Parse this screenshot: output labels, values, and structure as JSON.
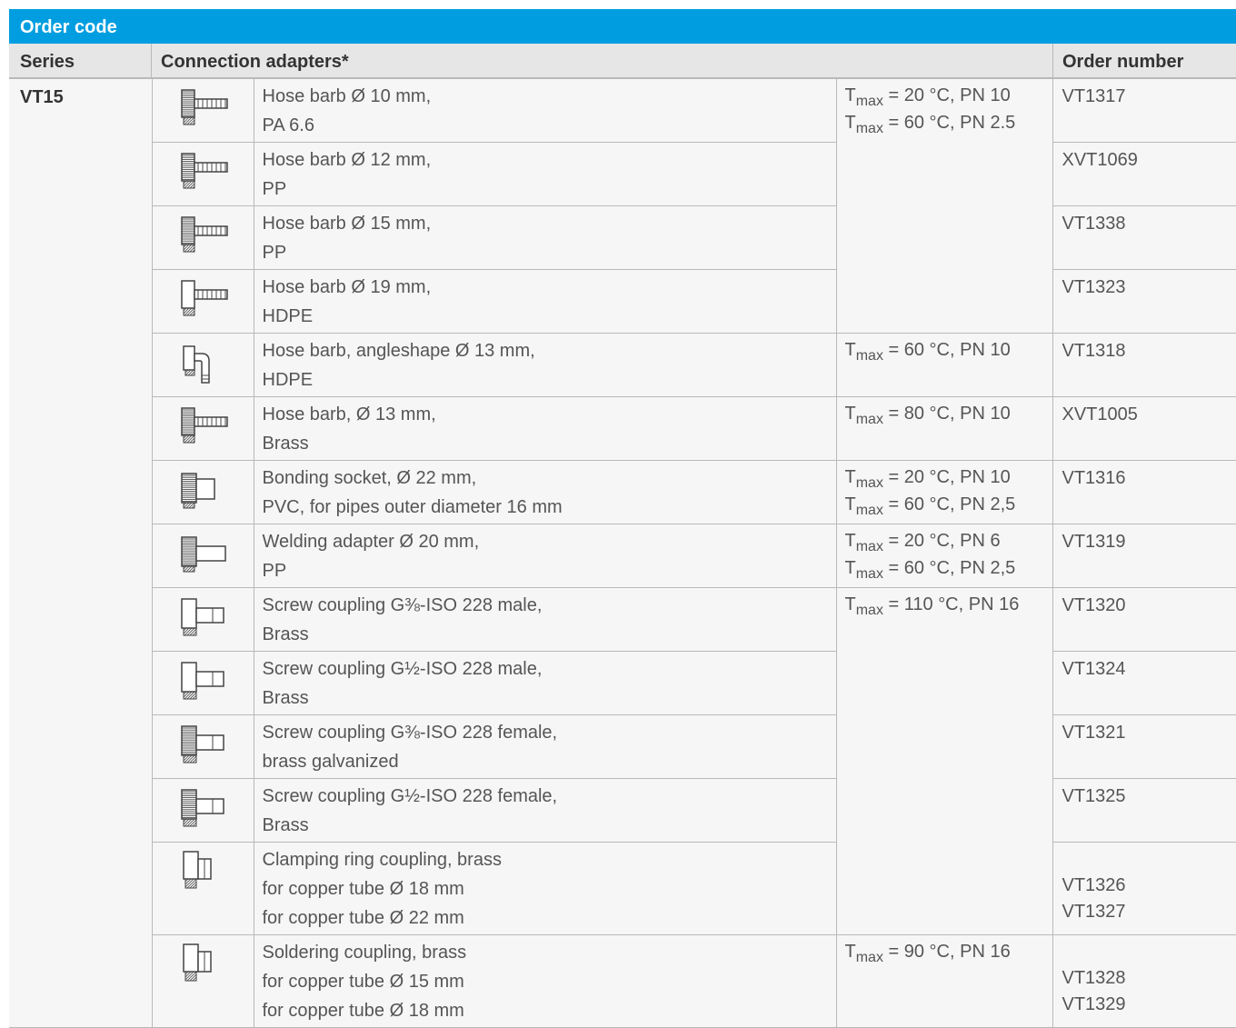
{
  "title": "Order code",
  "headers": {
    "series": "Series",
    "adapters": "Connection adapters*",
    "order": "Order number"
  },
  "series": "VT15",
  "temp_groups": [
    {
      "lines": [
        {
          "t": "T",
          "sub": "max",
          "rest": " = 20 °C, PN 10"
        },
        {
          "t": "T",
          "sub": "max",
          "rest": " = 60 °C, PN 2.5"
        }
      ]
    },
    {
      "lines": [
        {
          "t": "T",
          "sub": "max",
          "rest": " = 60 °C, PN 10"
        }
      ]
    },
    {
      "lines": [
        {
          "t": "T",
          "sub": "max",
          "rest": " = 80 °C, PN 10"
        }
      ]
    },
    {
      "lines": [
        {
          "t": "T",
          "sub": "max",
          "rest": " = 20 °C, PN 10"
        },
        {
          "t": "T",
          "sub": "max",
          "rest": " = 60 °C, PN 2,5"
        }
      ]
    },
    {
      "lines": [
        {
          "t": "T",
          "sub": "max",
          "rest": " = 20 °C, PN 6"
        },
        {
          "t": "T",
          "sub": "max",
          "rest": " = 60 °C, PN 2,5"
        }
      ]
    },
    {
      "lines": [
        {
          "t": "T",
          "sub": "max",
          "rest": " = 110 °C, PN 16"
        }
      ]
    },
    {
      "lines": [
        {
          "t": "T",
          "sub": "max",
          "rest": " = 90 °C, PN 16"
        }
      ]
    }
  ],
  "rows": [
    {
      "icon": "hose-barb-10-icon",
      "desc": [
        "Hose barb Ø 10 mm,",
        "PA 6.6"
      ],
      "order": [
        "VT1317"
      ]
    },
    {
      "icon": "hose-barb-12-icon",
      "desc": [
        "Hose barb Ø 12 mm,",
        "PP"
      ],
      "order": [
        "XVT1069"
      ]
    },
    {
      "icon": "hose-barb-15-icon",
      "desc": [
        "Hose barb Ø 15 mm,",
        "PP"
      ],
      "order": [
        "VT1338"
      ]
    },
    {
      "icon": "hose-barb-19-icon",
      "desc": [
        "Hose barb Ø 19 mm,",
        "HDPE"
      ],
      "order": [
        "VT1323"
      ]
    },
    {
      "icon": "hose-barb-angle-icon",
      "desc": [
        "Hose barb, angleshape Ø 13 mm,",
        "HDPE"
      ],
      "order": [
        "VT1318"
      ]
    },
    {
      "icon": "hose-barb-brass-icon",
      "desc": [
        "Hose barb, Ø 13 mm,",
        "Brass"
      ],
      "order": [
        "XVT1005"
      ]
    },
    {
      "icon": "bonding-socket-icon",
      "desc": [
        "Bonding socket, Ø 22 mm,",
        "PVC, for pipes outer diameter 16 mm"
      ],
      "order": [
        "VT1316"
      ]
    },
    {
      "icon": "welding-adapter-icon",
      "desc": [
        "Welding adapter Ø 20 mm,",
        "PP"
      ],
      "order": [
        "VT1319"
      ]
    },
    {
      "icon": "screw-coupling-male-38-icon",
      "desc": [
        "Screw coupling G⅜-ISO 228 male,",
        "Brass"
      ],
      "order": [
        "VT1320"
      ]
    },
    {
      "icon": "screw-coupling-male-12-icon",
      "desc": [
        "Screw coupling G½-ISO 228 male,",
        "Brass"
      ],
      "order": [
        "VT1324"
      ]
    },
    {
      "icon": "screw-coupling-female-38-icon",
      "desc": [
        "Screw coupling G⅜-ISO 228 female,",
        "brass galvanized"
      ],
      "order": [
        "VT1321"
      ]
    },
    {
      "icon": "screw-coupling-female-12-icon",
      "desc": [
        "Screw coupling G½-ISO 228 female,",
        "Brass"
      ],
      "order": [
        "VT1325"
      ]
    },
    {
      "icon": "clamping-ring-coupling-icon",
      "desc": [
        "Clamping ring coupling, brass",
        "for copper tube Ø 18 mm",
        "for copper tube Ø 22 mm"
      ],
      "order": [
        "VT1326",
        "VT1327"
      ]
    },
    {
      "icon": "soldering-coupling-icon",
      "desc": [
        "Soldering coupling, brass",
        "for copper tube Ø 15 mm",
        "for copper tube Ø 18 mm"
      ],
      "order": [
        "VT1328",
        "VT1329"
      ]
    }
  ]
}
